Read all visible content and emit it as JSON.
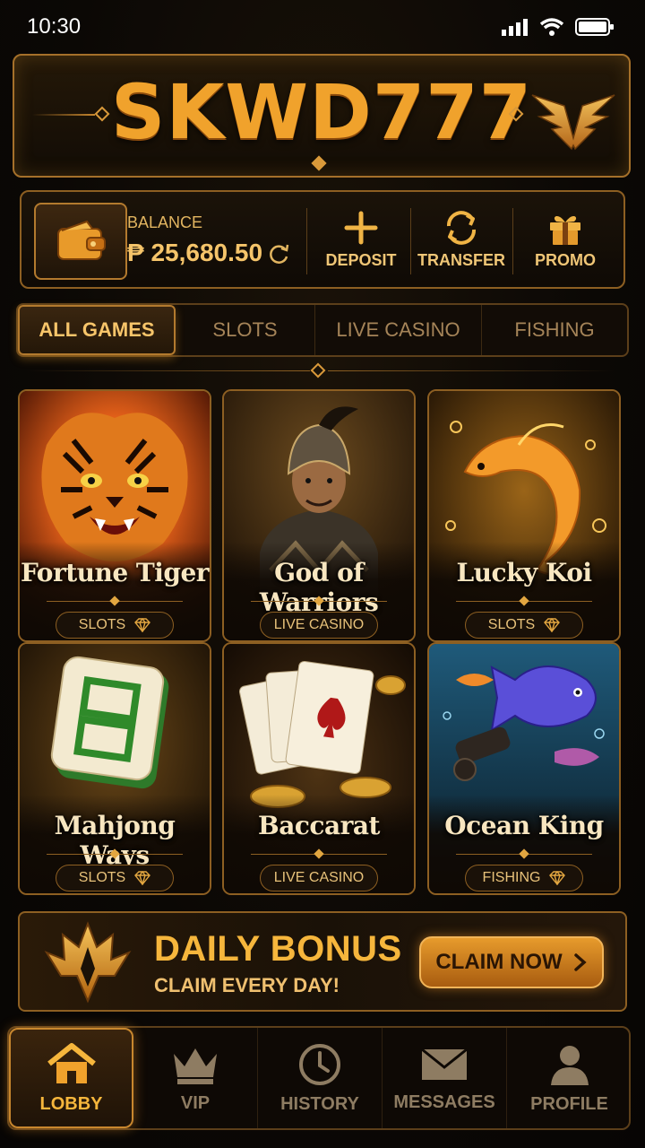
{
  "status_bar": {
    "time": "10:30"
  },
  "header": {
    "logo_text": "SKWD777"
  },
  "wallet": {
    "balance_label": "BALANCE",
    "balance_amount": "₱ 25,680.50",
    "actions": [
      {
        "label": "DEPOSIT",
        "icon": "plus-icon"
      },
      {
        "label": "TRANSFER",
        "icon": "transfer-icon"
      },
      {
        "label": "PROMO",
        "icon": "gift-icon"
      }
    ]
  },
  "tabs": [
    {
      "label": "ALL GAMES",
      "active": true
    },
    {
      "label": "SLOTS",
      "active": false
    },
    {
      "label": "LIVE CASINO",
      "active": false
    },
    {
      "label": "FISHING",
      "active": false
    }
  ],
  "games": [
    {
      "title": "Fortune Tiger",
      "category": "SLOTS"
    },
    {
      "title": "God of Warriors",
      "category": "LIVE CASINO"
    },
    {
      "title": "Lucky Koi",
      "category": "SLOTS"
    },
    {
      "title": "Mahjong Ways",
      "category": "SLOTS"
    },
    {
      "title": "Baccarat",
      "category": "LIVE CASINO"
    },
    {
      "title": "Ocean King",
      "category": "FISHING"
    }
  ],
  "bonus": {
    "title": "DAILY BONUS",
    "subtitle": "CLAIM EVERY DAY!",
    "button_label": "CLAIM NOW"
  },
  "bottom_nav": [
    {
      "label": "LOBBY",
      "icon": "home-icon",
      "active": true
    },
    {
      "label": "VIP",
      "icon": "crown-icon",
      "active": false
    },
    {
      "label": "HISTORY",
      "icon": "clock-icon",
      "active": false
    },
    {
      "label": "MESSAGES",
      "icon": "mail-icon",
      "active": false
    },
    {
      "label": "PROFILE",
      "icon": "user-icon",
      "active": false
    }
  ],
  "colors": {
    "accent": "#f0a22c",
    "border": "#8d5f22",
    "background": "#0b0805"
  }
}
